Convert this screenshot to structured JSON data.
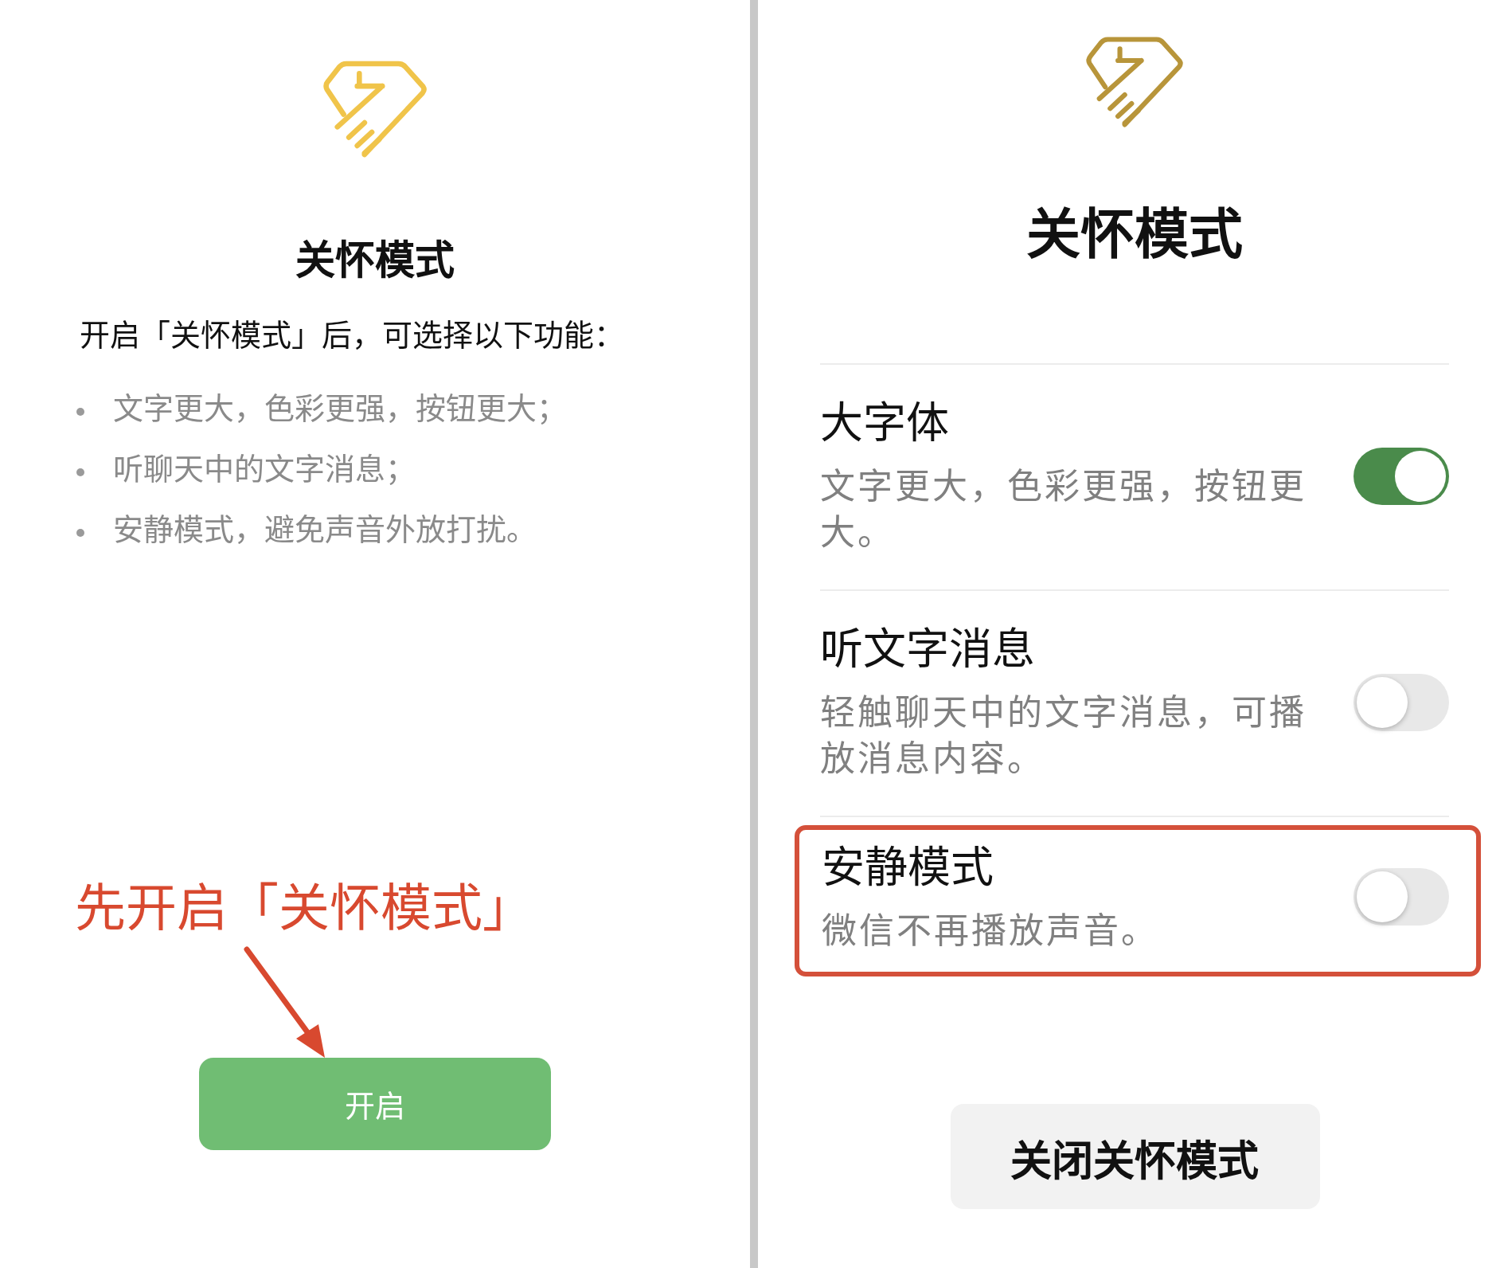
{
  "left_screen": {
    "title": "关怀模式",
    "intro": "开启「关怀模式」后，可选择以下功能：",
    "features": [
      "文字更大，色彩更强，按钮更大；",
      "听聊天中的文字消息；",
      "安静模式，避免声音外放打扰。"
    ],
    "annotation": {
      "text": "先开启「关怀模式」"
    },
    "button": "开启"
  },
  "right_screen": {
    "title": "关怀模式",
    "settings": [
      {
        "title": "大字体",
        "description": "文字更大，色彩更强，按钮更大。",
        "on": true,
        "highlighted": false
      },
      {
        "title": "听文字消息",
        "description": "轻触聊天中的文字消息，可播放消息内容。",
        "on": false,
        "highlighted": false
      },
      {
        "title": "安静模式",
        "description": "微信不再播放声音。",
        "on": false,
        "highlighted": true
      }
    ],
    "button": "关闭关怀模式"
  }
}
